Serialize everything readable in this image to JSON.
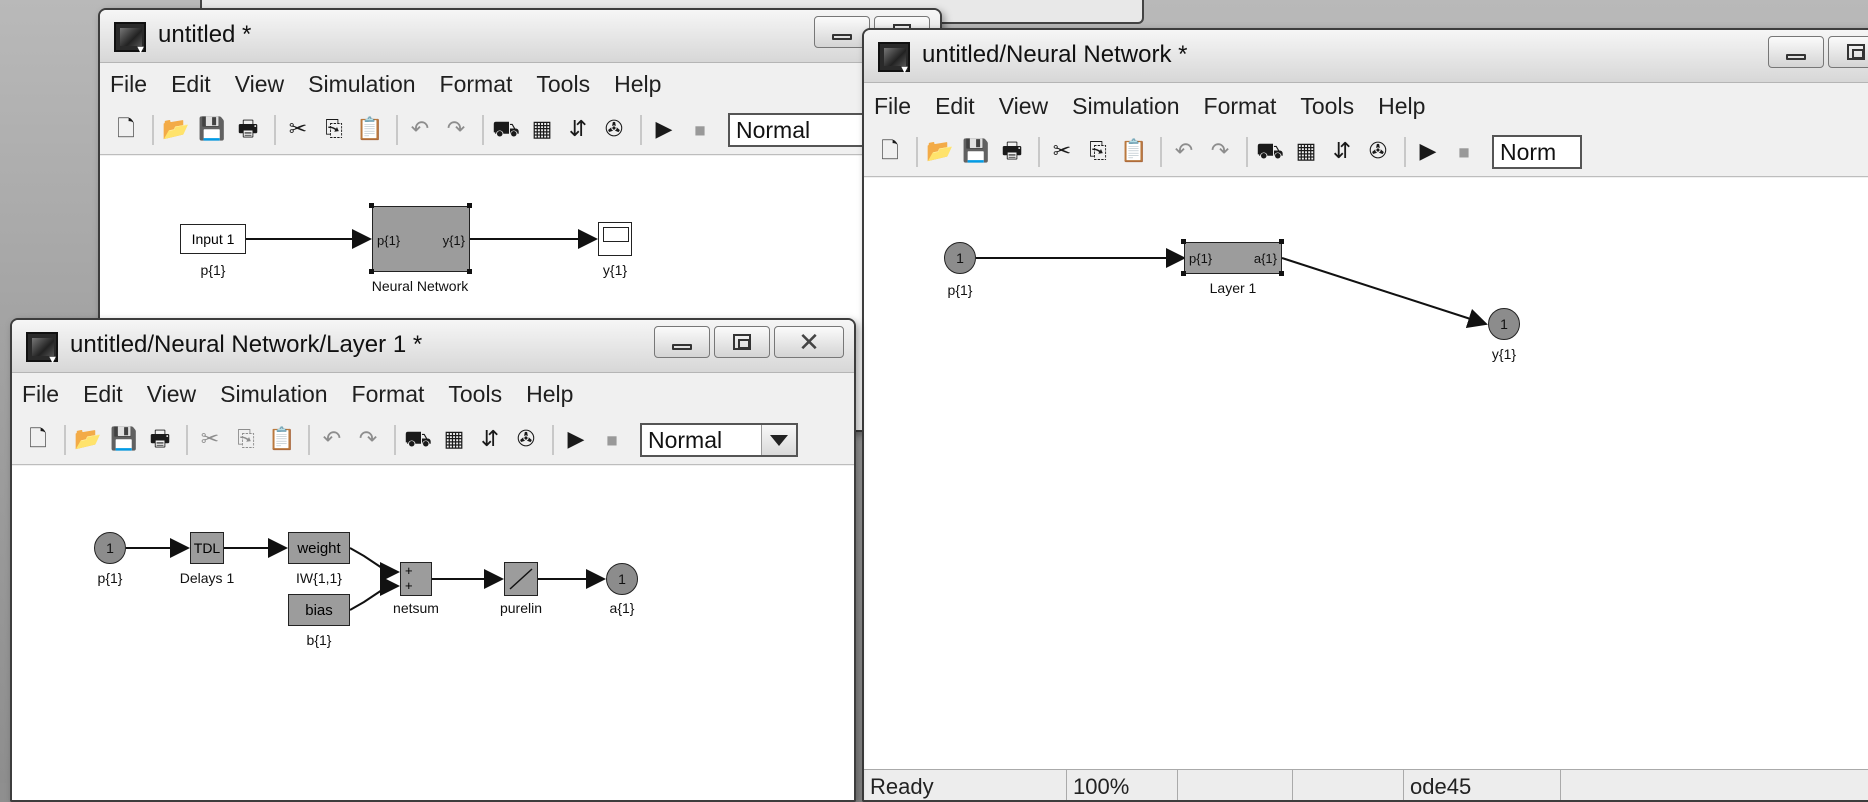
{
  "windows": {
    "main": {
      "title": "untitled *",
      "menu": [
        "File",
        "Edit",
        "View",
        "Simulation",
        "Format",
        "Tools",
        "Help"
      ],
      "sim_mode": "Normal",
      "blocks": {
        "input": {
          "text": "Input 1",
          "label": "p{1}"
        },
        "nn": {
          "in_port": "p{1}",
          "out_port": "y{1}",
          "label": "Neural Network"
        },
        "scope": {
          "label": "y{1}"
        }
      }
    },
    "nn": {
      "title": "untitled/Neural Network *",
      "menu": [
        "File",
        "Edit",
        "View",
        "Simulation",
        "Format",
        "Tools",
        "Help"
      ],
      "sim_mode": "Norm",
      "blocks": {
        "inport": {
          "num": "1",
          "label": "p{1}"
        },
        "layer": {
          "in_port": "p{1}",
          "out_port": "a{1}",
          "label": "Layer 1"
        },
        "outport": {
          "num": "1",
          "label": "y{1}"
        }
      },
      "status": {
        "state": "Ready",
        "zoom": "100%",
        "solver": "ode45"
      }
    },
    "layer": {
      "title": "untitled/Neural Network/Layer 1 *",
      "menu": [
        "File",
        "Edit",
        "View",
        "Simulation",
        "Format",
        "Tools",
        "Help"
      ],
      "sim_mode": "Normal",
      "blocks": {
        "inport": {
          "num": "1",
          "label": "p{1}"
        },
        "tdl": {
          "text": "TDL",
          "label": "Delays 1"
        },
        "weight": {
          "text": "weight",
          "label": "IW{1,1}"
        },
        "bias": {
          "text": "bias",
          "label": "b{1}"
        },
        "netsum": {
          "signs": "+\n+",
          "label": "netsum"
        },
        "purelin": {
          "label": "purelin"
        },
        "outport": {
          "num": "1",
          "label": "a{1}"
        }
      }
    }
  },
  "toolbar_icons": [
    "new-icon",
    "open-icon",
    "save-icon",
    "print-icon",
    "cut-icon",
    "copy-icon",
    "paste-icon",
    "undo-icon",
    "redo-icon",
    "library-browser-icon",
    "model-explorer-icon",
    "debugger-icon",
    "configuration-icon",
    "run-icon",
    "stop-icon"
  ]
}
